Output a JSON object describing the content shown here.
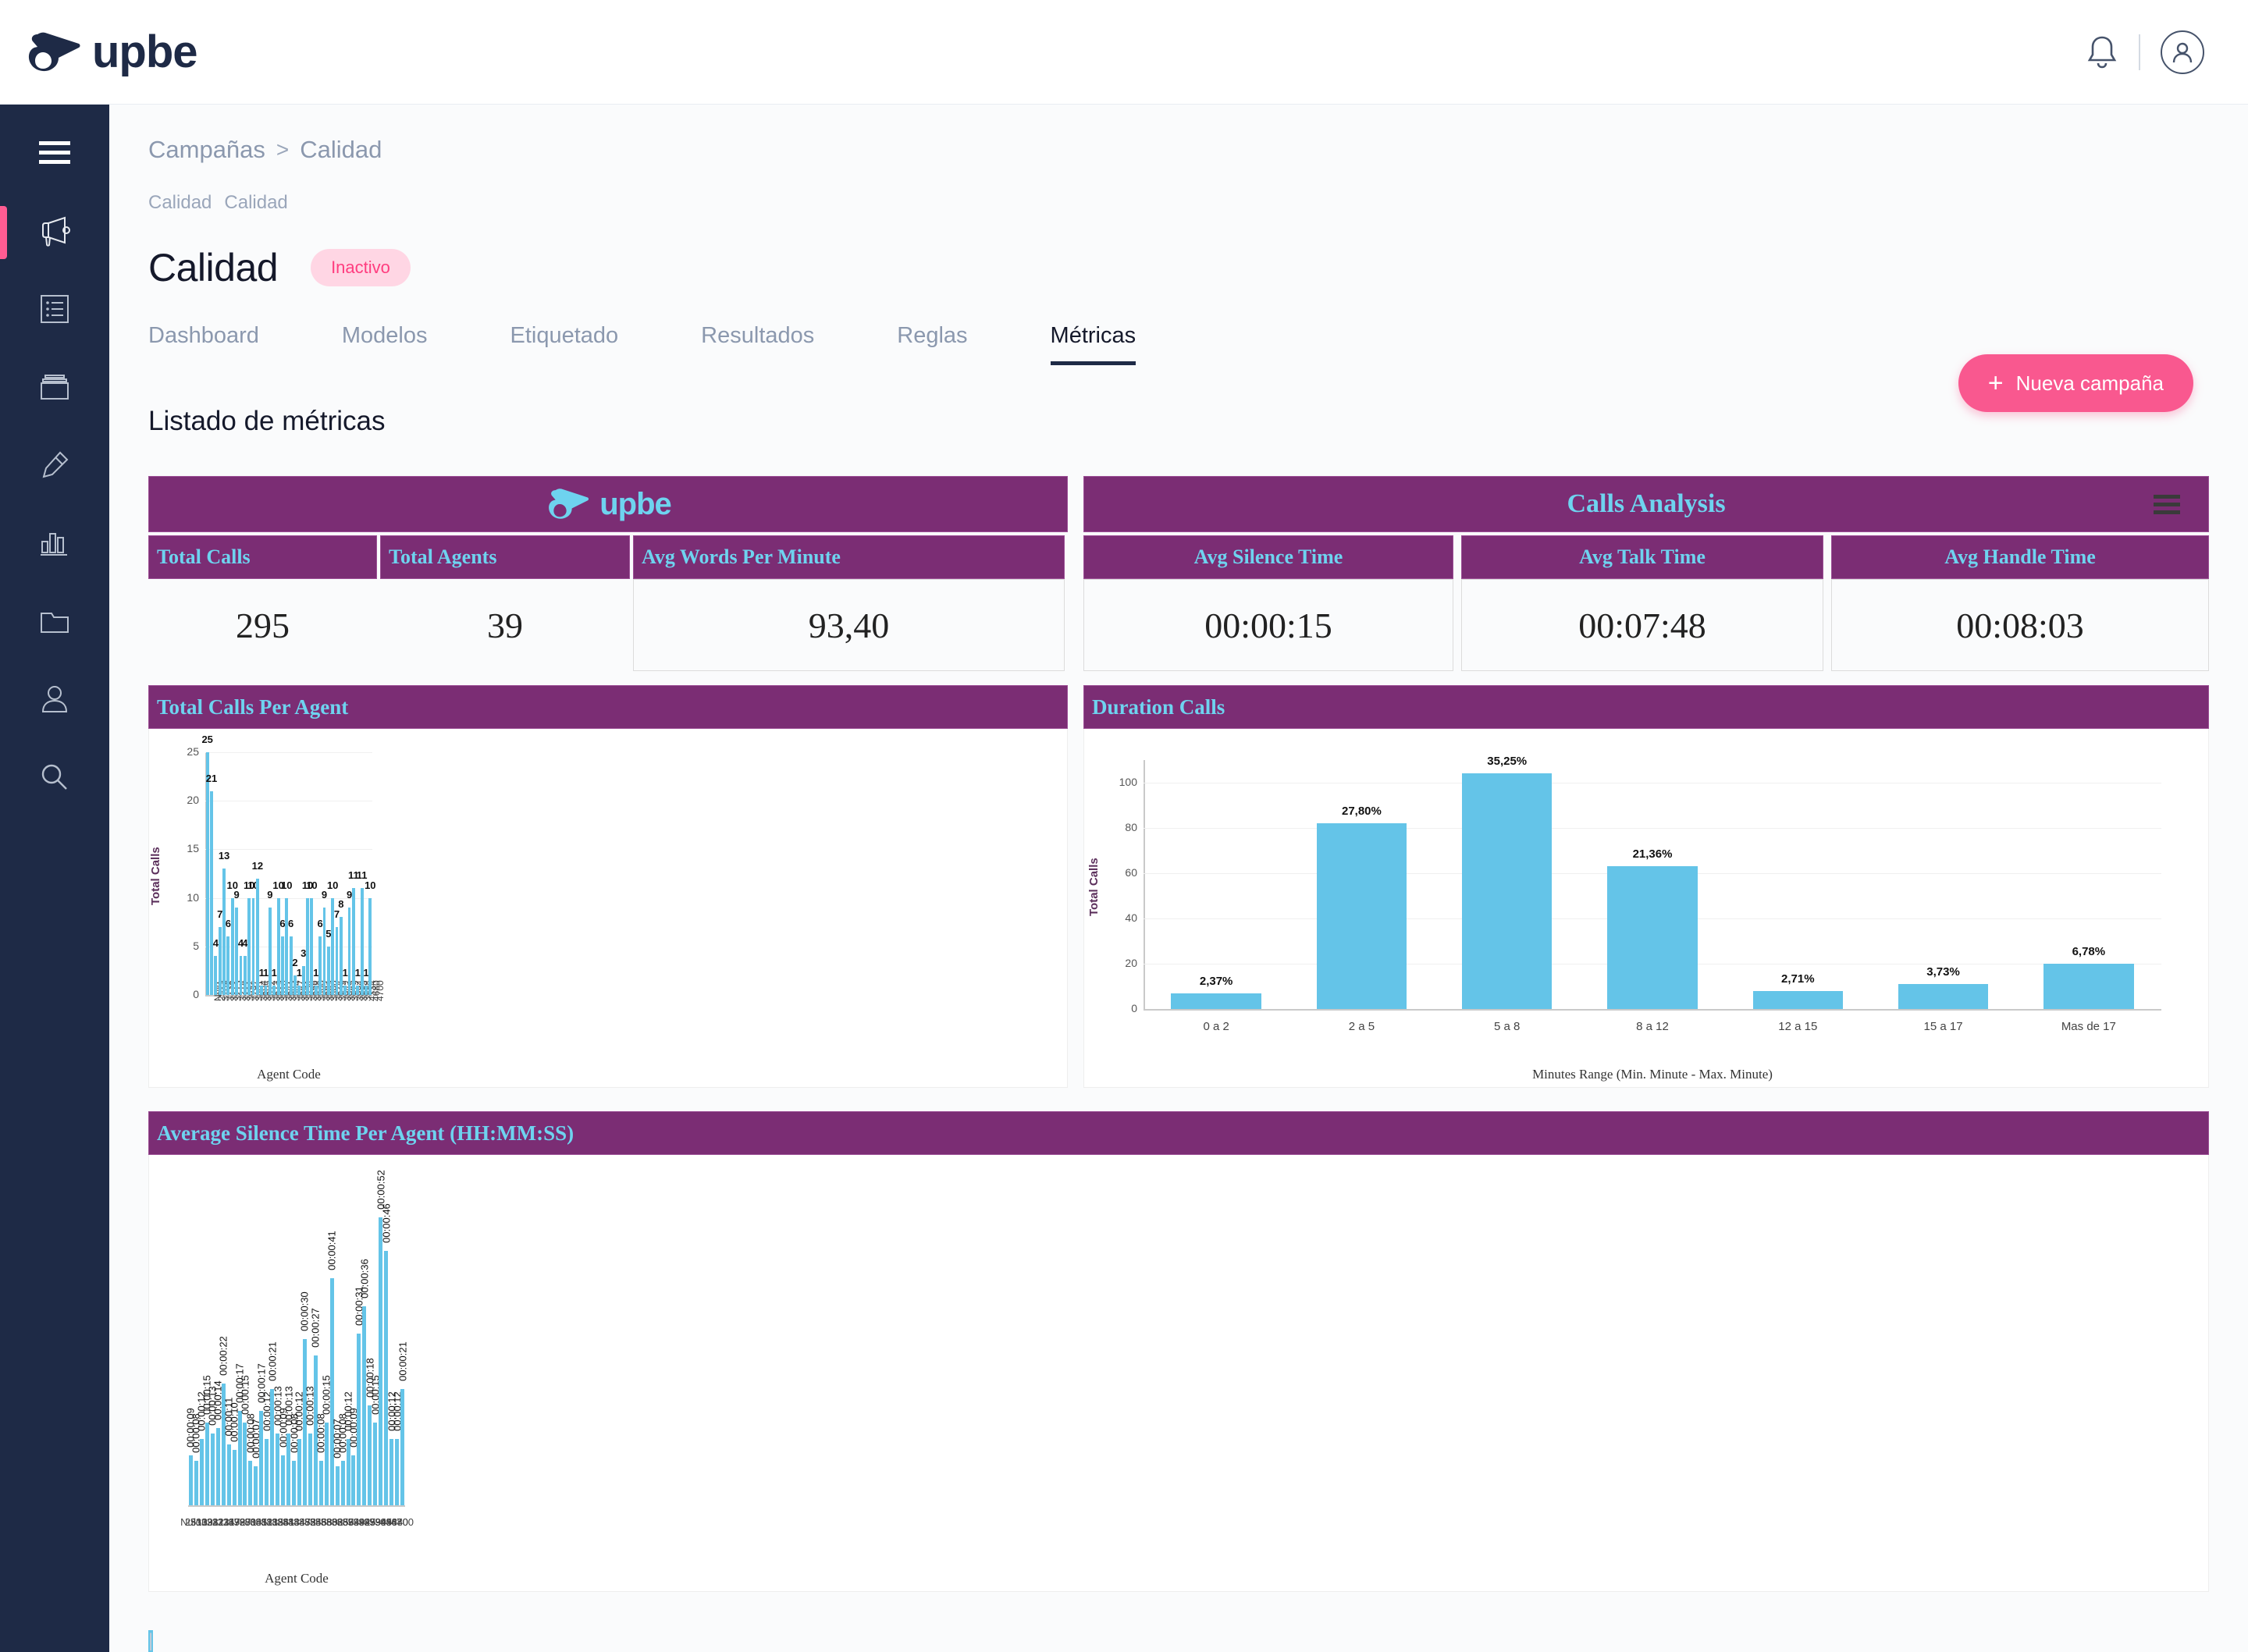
{
  "brand": {
    "name": "upbe"
  },
  "topbar": {
    "bell_icon": "bell-icon",
    "avatar_icon": "user-avatar-icon"
  },
  "sidebar": {
    "items": [
      {
        "icon": "hamburger-menu-icon",
        "name": "menu-toggle"
      },
      {
        "icon": "megaphone-icon",
        "name": "campaigns"
      },
      {
        "icon": "list-icon",
        "name": "lists"
      },
      {
        "icon": "card-icon",
        "name": "cards"
      },
      {
        "icon": "highlighter-icon",
        "name": "annotations"
      },
      {
        "icon": "bar-chart-icon",
        "name": "analytics"
      },
      {
        "icon": "folder-icon",
        "name": "files"
      },
      {
        "icon": "user-icon",
        "name": "users"
      },
      {
        "icon": "search-icon",
        "name": "search"
      }
    ]
  },
  "breadcrumb": {
    "root": "Campañas",
    "separator": ">",
    "current": "Calidad"
  },
  "subcrumb": {
    "left": "Calidad",
    "divider": "|",
    "right": "Calidad"
  },
  "header": {
    "title": "Calidad",
    "status": "Inactivo",
    "new_campaign_label": "Nueva campaña",
    "new_campaign_plus": "+"
  },
  "tabs": [
    {
      "label": "Dashboard",
      "active": false
    },
    {
      "label": "Modelos",
      "active": false
    },
    {
      "label": "Etiquetado",
      "active": false
    },
    {
      "label": "Resultados",
      "active": false
    },
    {
      "label": "Reglas",
      "active": false
    },
    {
      "label": "Métricas",
      "active": true
    }
  ],
  "section": {
    "title": "Listado de métricas"
  },
  "report": {
    "left_panel_brand": "upbe",
    "right_panel_title": "Calls Analysis",
    "kpis_left": [
      {
        "label": "Total Calls",
        "value": "295"
      },
      {
        "label": "Total Agents",
        "value": "39"
      },
      {
        "label": "Avg Words Per Minute",
        "value": "93,40"
      }
    ],
    "kpis_right": [
      {
        "label": "Avg Silence Time",
        "value": "00:00:15"
      },
      {
        "label": "Avg Talk Time",
        "value": "00:07:48"
      },
      {
        "label": "Avg Handle Time",
        "value": "00:08:03"
      }
    ],
    "chart_titles": {
      "total_calls_per_agent": "Total Calls Per Agent",
      "duration_calls": "Duration Calls",
      "avg_silence": "Average Silence Time Per Agent (HH:MM:SS)"
    }
  },
  "chart_data": [
    {
      "id": "total-calls-per-agent",
      "type": "bar",
      "title": "Total Calls Per Agent",
      "xlabel": "Agent Code",
      "ylabel": "Total Calls",
      "ylim": [
        0,
        25
      ],
      "yticks": [
        0,
        5,
        10,
        15,
        20,
        25
      ],
      "grid": true,
      "bar_color": "#64c4e8",
      "categories": [
        "Nulo",
        "2513",
        "3109",
        "3138",
        "3212",
        "3213",
        "3214",
        "3217",
        "3692",
        "3797",
        "3801",
        "3804",
        "3805",
        "3812",
        "3813",
        "3815",
        "3826",
        "3841",
        "3843",
        "3844",
        "3847",
        "3852",
        "3854",
        "3856",
        "3858",
        "3860",
        "3862",
        "3865",
        "3866",
        "3874",
        "3939",
        "3942",
        "3945",
        "3979",
        "3994",
        "3995",
        "3998",
        "4334",
        "4680",
        "4700"
      ],
      "values": [
        25,
        21,
        4,
        7,
        13,
        6,
        10,
        9,
        4,
        4,
        10,
        10,
        12,
        1,
        1,
        9,
        1,
        10,
        6,
        10,
        6,
        2,
        1,
        3,
        10,
        10,
        1,
        6,
        9,
        5,
        10,
        7,
        8,
        1,
        9,
        11,
        1,
        11,
        1,
        10
      ],
      "labels": [
        "25",
        "21",
        "4",
        "7",
        "13",
        "6",
        "10",
        "9",
        "4",
        "4",
        "10",
        "10",
        "12",
        "1",
        "1",
        "9",
        "1",
        "10",
        "6",
        "10",
        "6",
        "2",
        "1",
        "3",
        "10",
        "10",
        "1",
        "6",
        "9",
        "5",
        "10",
        "7",
        "8",
        "1",
        "9",
        "11",
        "1",
        "11",
        "1",
        "10"
      ]
    },
    {
      "id": "duration-calls",
      "type": "bar",
      "title": "Duration Calls",
      "xlabel": "Minutes Range (Min. Minute - Max. Minute)",
      "ylabel": "Total Calls",
      "ylim": [
        0,
        110
      ],
      "yticks": [
        0,
        20,
        40,
        60,
        80,
        100
      ],
      "grid": true,
      "bar_color": "#64c4e8",
      "categories": [
        "0 a 2",
        "2 a 5",
        "5 a 8",
        "8 a 12",
        "12 a 15",
        "15 a 17",
        "Mas de 17"
      ],
      "values": [
        7,
        82,
        104,
        63,
        8,
        11,
        20
      ],
      "labels": [
        "2,37%",
        "27,80%",
        "35,25%",
        "21,36%",
        "2,71%",
        "3,73%",
        "6,78%"
      ]
    },
    {
      "id": "avg-silence-per-agent",
      "type": "bar",
      "title": "Average Silence Time Per Agent (HH:MM:SS)",
      "xlabel": "Agent Code",
      "ylabel": "",
      "ylim": [
        0,
        52
      ],
      "grid": false,
      "bar_color": "#64c4e8",
      "categories": [
        "Nulo",
        "2513",
        "3109",
        "3138",
        "3212",
        "3213",
        "3214",
        "3217",
        "3692",
        "3797",
        "3801",
        "3804",
        "3805",
        "3812",
        "3813",
        "3815",
        "3826",
        "3841",
        "3843",
        "3844",
        "3847",
        "3852",
        "3854",
        "3856",
        "3858",
        "3860",
        "3862",
        "3865",
        "3866",
        "3874",
        "3939",
        "3942",
        "3945",
        "3979",
        "3994",
        "3995",
        "3998",
        "4334",
        "4680",
        "4700"
      ],
      "values": [
        9,
        8,
        12,
        15,
        13,
        14,
        22,
        11,
        10,
        17,
        15,
        8,
        7,
        17,
        12,
        21,
        13,
        9,
        13,
        8,
        12,
        30,
        13,
        27,
        8,
        15,
        41,
        7,
        8,
        12,
        9,
        31,
        36,
        18,
        15,
        52,
        46,
        12,
        12,
        21
      ],
      "labels": [
        "00:00:09",
        "00:00:08",
        "00:00:12",
        "00:00:15",
        "00:00:13",
        "00:00:14",
        "00:00:22",
        "00:00:11",
        "00:00:10",
        "00:00:17",
        "00:00:15",
        "00:00:08",
        "00:00:07",
        "00:00:17",
        "00:00:12",
        "00:00:21",
        "00:00:13",
        "00:00:09",
        "00:00:13",
        "00:00:08",
        "00:00:12",
        "00:00:30",
        "00:00:13",
        "00:00:27",
        "00:00:08",
        "00:00:15",
        "00:00:41",
        "00:00:07",
        "00:00:08",
        "00:00:12",
        "00:00:09",
        "00:00:31",
        "00:00:36",
        "00:00:18",
        "00:00:15",
        "00:00:52",
        "00:00:46",
        "00:00:12",
        "00:00:12",
        "00:00:21"
      ]
    }
  ],
  "colors": {
    "brand_navy": "#1e2a46",
    "accent_pink": "#f9588f",
    "panel_purple": "#7b2d74",
    "panel_cyan": "#6ed3ef",
    "bar_blue": "#64c4e8"
  }
}
